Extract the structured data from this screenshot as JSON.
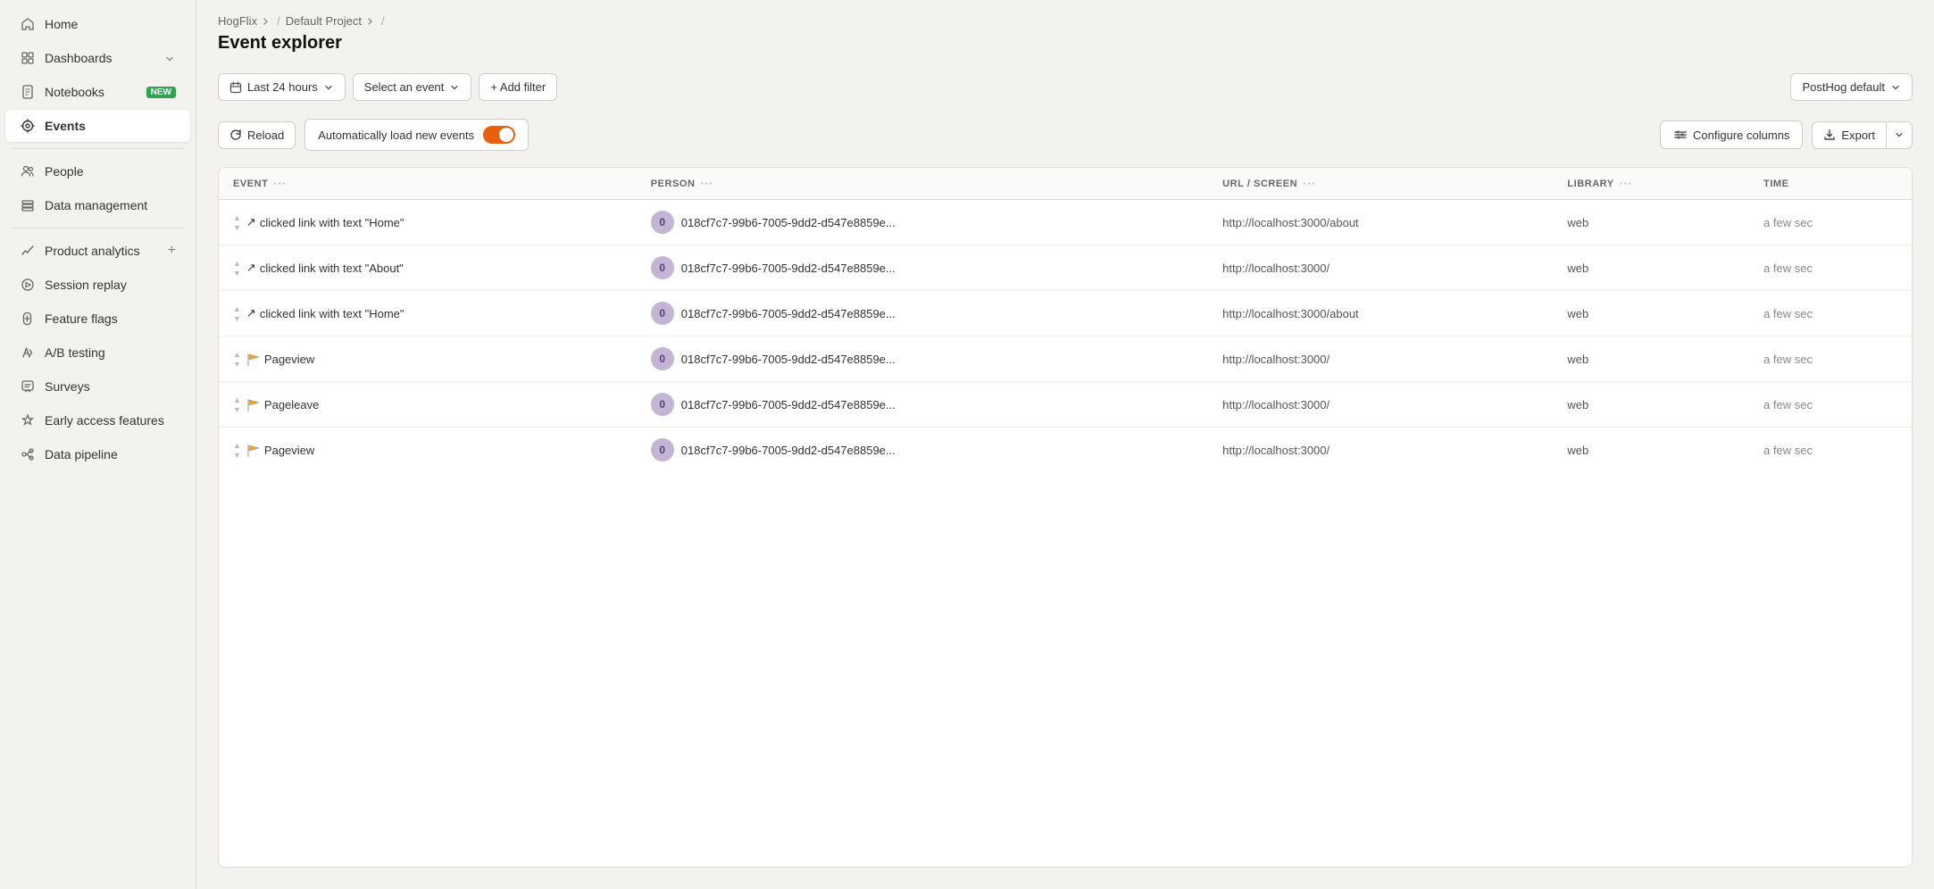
{
  "sidebar": {
    "items": [
      {
        "id": "home",
        "label": "Home",
        "icon": "home",
        "active": false
      },
      {
        "id": "dashboards",
        "label": "Dashboards",
        "icon": "dashboards",
        "active": false,
        "hasChevron": true
      },
      {
        "id": "notebooks",
        "label": "Notebooks",
        "icon": "notebooks",
        "active": false,
        "badge": "NEW"
      },
      {
        "id": "events",
        "label": "Events",
        "icon": "events",
        "active": true
      },
      {
        "id": "people",
        "label": "People",
        "icon": "people",
        "active": false
      },
      {
        "id": "data-management",
        "label": "Data management",
        "icon": "data-management",
        "active": false
      },
      {
        "id": "product-analytics",
        "label": "Product analytics",
        "icon": "product-analytics",
        "active": false,
        "hasPlus": true
      },
      {
        "id": "session-replay",
        "label": "Session replay",
        "icon": "session-replay",
        "active": false
      },
      {
        "id": "feature-flags",
        "label": "Feature flags",
        "icon": "feature-flags",
        "active": false
      },
      {
        "id": "ab-testing",
        "label": "A/B testing",
        "icon": "ab-testing",
        "active": false
      },
      {
        "id": "surveys",
        "label": "Surveys",
        "icon": "surveys",
        "active": false
      },
      {
        "id": "early-access",
        "label": "Early access features",
        "icon": "early-access",
        "active": false
      },
      {
        "id": "data-pipeline",
        "label": "Data pipeline",
        "icon": "data-pipeline",
        "active": false
      }
    ]
  },
  "breadcrumb": {
    "items": [
      {
        "label": "HogFlix",
        "hasChevron": true
      },
      {
        "label": "Default Project",
        "hasChevron": true
      }
    ]
  },
  "page": {
    "title": "Event explorer"
  },
  "toolbar": {
    "date_range_label": "Last 24 hours",
    "event_selector_label": "Select an event",
    "add_filter_label": "+ Add filter",
    "cluster_label": "PostHog default"
  },
  "actions": {
    "reload_label": "Reload",
    "auto_load_label": "Automatically load new events",
    "configure_columns_label": "Configure columns",
    "export_label": "Export"
  },
  "table": {
    "columns": [
      {
        "id": "event",
        "label": "EVENT"
      },
      {
        "id": "person",
        "label": "PERSON"
      },
      {
        "id": "url",
        "label": "URL / SCREEN"
      },
      {
        "id": "library",
        "label": "LIBRARY"
      },
      {
        "id": "time",
        "label": "TIME"
      }
    ],
    "rows": [
      {
        "event": "clicked link with text \"Home\"",
        "event_icon": "🔗",
        "person_id": "018cf7c7-99b6-7005-9dd2-d547e8859e...",
        "person_avatar": "0",
        "url": "http://localhost:3000/about",
        "library": "web",
        "time": "a few sec"
      },
      {
        "event": "clicked link with text \"About\"",
        "event_icon": "🔗",
        "person_id": "018cf7c7-99b6-7005-9dd2-d547e8859e...",
        "person_avatar": "0",
        "url": "http://localhost:3000/",
        "library": "web",
        "time": "a few sec"
      },
      {
        "event": "clicked link with text \"Home\"",
        "event_icon": "🔗",
        "person_id": "018cf7c7-99b6-7005-9dd2-d547e8859e...",
        "person_avatar": "0",
        "url": "http://localhost:3000/about",
        "library": "web",
        "time": "a few sec"
      },
      {
        "event": "Pageview",
        "event_icon": "📄",
        "person_id": "018cf7c7-99b6-7005-9dd2-d547e8859e...",
        "person_avatar": "0",
        "url": "http://localhost:3000/",
        "library": "web",
        "time": "a few sec"
      },
      {
        "event": "Pageleave",
        "event_icon": "📄",
        "person_id": "018cf7c7-99b6-7005-9dd2-d547e8859e...",
        "person_avatar": "0",
        "url": "http://localhost:3000/",
        "library": "web",
        "time": "a few sec"
      },
      {
        "event": "Pageview",
        "event_icon": "📄",
        "person_id": "018cf7c7-99b6-7005-9dd2-d547e8859e...",
        "person_avatar": "0",
        "url": "http://localhost:3000/",
        "library": "web",
        "time": "a few sec"
      }
    ]
  }
}
